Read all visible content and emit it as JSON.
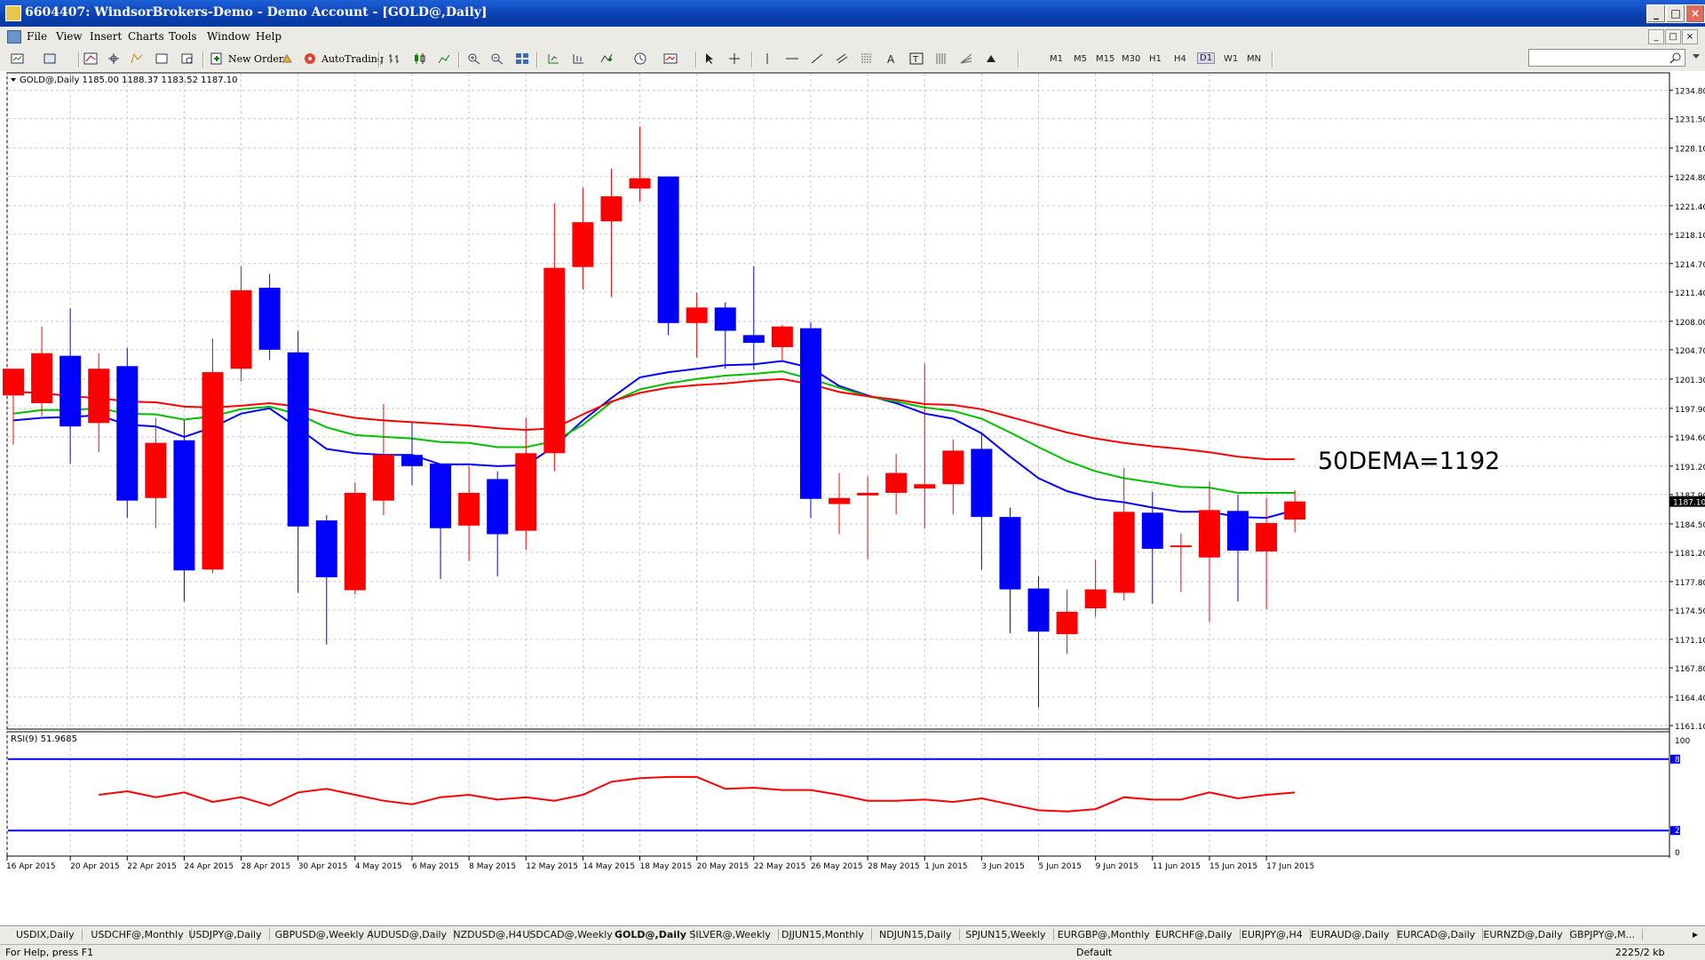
{
  "window": {
    "title": "6604407: WindsorBrokers-Demo - Demo Account - [GOLD@,Daily]",
    "minimize": "_",
    "maximize": "□",
    "close": "×"
  },
  "menu": {
    "items": [
      "File",
      "View",
      "Insert",
      "Charts",
      "Tools",
      "Window",
      "Help"
    ]
  },
  "toolbar": {
    "new_order": "New Order",
    "autotrading": "AutoTrading",
    "timeframes": [
      "M1",
      "M5",
      "M15",
      "M30",
      "H1",
      "H4",
      "D1",
      "W1",
      "MN"
    ],
    "active_timeframe": "D1"
  },
  "colors": {
    "bull": "#ff0000",
    "bear": "#0000ff",
    "ema_fast": "#0000ff",
    "ema_mid": "#00c000",
    "ema_slow": "#ff0000",
    "rsi_line": "#ff0000",
    "rsi_levels": "#0000ff",
    "grid": "#c8c8c8"
  },
  "chart_data": [
    {
      "type": "candlestick",
      "header": "GOLD@,Daily  1185.00 1188.37 1183.52 1187.10",
      "annotation": "50DEMA=1192",
      "current_price_label": "1187.10",
      "ylim": [
        1161.1,
        1235.8
      ],
      "grid": true,
      "y_ticks": [
        "1234.80",
        "1231.50",
        "1228.10",
        "1224.80",
        "1221.40",
        "1218.10",
        "1214.70",
        "1211.40",
        "1208.00",
        "1204.70",
        "1201.30",
        "1197.90",
        "1194.60",
        "1191.20",
        "1187.90",
        "1184.50",
        "1181.20",
        "1177.80",
        "1174.50",
        "1171.10",
        "1167.80",
        "1164.40",
        "1161.10"
      ],
      "x_ticks": [
        "16 Apr 2015",
        "20 Apr 2015",
        "22 Apr 2015",
        "24 Apr 2015",
        "28 Apr 2015",
        "30 Apr 2015",
        "4 May 2015",
        "6 May 2015",
        "8 May 2015",
        "12 May 2015",
        "14 May 2015",
        "18 May 2015",
        "20 May 2015",
        "22 May 2015",
        "26 May 2015",
        "28 May 2015",
        "1 Jun 2015",
        "3 Jun 2015",
        "5 Jun 2015",
        "9 Jun 2015",
        "11 Jun 2015",
        "15 Jun 2015",
        "17 Jun 2015"
      ],
      "candles": [
        {
          "o": 1199.4,
          "h": 1201.8,
          "l": 1193.7,
          "c": 1202.5
        },
        {
          "o": 1198.5,
          "h": 1207.4,
          "l": 1197.0,
          "c": 1204.3
        },
        {
          "o": 1204.0,
          "h": 1209.5,
          "l": 1191.5,
          "c": 1195.8
        },
        {
          "o": 1196.2,
          "h": 1204.3,
          "l": 1192.8,
          "c": 1202.5
        },
        {
          "o": 1202.8,
          "h": 1204.9,
          "l": 1185.2,
          "c": 1187.2
        },
        {
          "o": 1187.5,
          "h": 1196.8,
          "l": 1184.0,
          "c": 1193.9
        },
        {
          "o": 1194.2,
          "h": 1196.5,
          "l": 1175.5,
          "c": 1179.1
        },
        {
          "o": 1179.2,
          "h": 1206.0,
          "l": 1178.8,
          "c": 1202.1
        },
        {
          "o": 1202.5,
          "h": 1214.4,
          "l": 1201.0,
          "c": 1211.6
        },
        {
          "o": 1211.9,
          "h": 1213.5,
          "l": 1203.5,
          "c": 1204.7
        },
        {
          "o": 1204.4,
          "h": 1206.9,
          "l": 1176.5,
          "c": 1184.2
        },
        {
          "o": 1184.9,
          "h": 1185.5,
          "l": 1170.5,
          "c": 1178.3
        },
        {
          "o": 1176.8,
          "h": 1189.3,
          "l": 1176.3,
          "c": 1188.1
        },
        {
          "o": 1187.2,
          "h": 1198.4,
          "l": 1185.5,
          "c": 1192.5
        },
        {
          "o": 1192.5,
          "h": 1196.3,
          "l": 1189.0,
          "c": 1191.2
        },
        {
          "o": 1191.5,
          "h": 1191.5,
          "l": 1178.1,
          "c": 1184.0
        },
        {
          "o": 1184.3,
          "h": 1191.2,
          "l": 1180.2,
          "c": 1188.1
        },
        {
          "o": 1189.7,
          "h": 1190.6,
          "l": 1178.4,
          "c": 1183.3
        },
        {
          "o": 1183.7,
          "h": 1196.8,
          "l": 1181.5,
          "c": 1192.7
        },
        {
          "o": 1192.7,
          "h": 1221.7,
          "l": 1190.6,
          "c": 1214.2
        },
        {
          "o": 1214.3,
          "h": 1223.5,
          "l": 1211.7,
          "c": 1219.5
        },
        {
          "o": 1219.6,
          "h": 1225.7,
          "l": 1210.8,
          "c": 1222.5
        },
        {
          "o": 1223.4,
          "h": 1230.6,
          "l": 1221.9,
          "c": 1224.6
        },
        {
          "o": 1224.8,
          "h": 1224.8,
          "l": 1206.4,
          "c": 1207.8
        },
        {
          "o": 1207.8,
          "h": 1211.3,
          "l": 1203.8,
          "c": 1209.6
        },
        {
          "o": 1209.6,
          "h": 1210.2,
          "l": 1202.5,
          "c": 1206.9
        },
        {
          "o": 1206.4,
          "h": 1214.4,
          "l": 1202.4,
          "c": 1205.5
        },
        {
          "o": 1205.0,
          "h": 1207.6,
          "l": 1203.4,
          "c": 1207.4
        },
        {
          "o": 1207.2,
          "h": 1207.9,
          "l": 1185.2,
          "c": 1187.4
        },
        {
          "o": 1186.8,
          "h": 1190.4,
          "l": 1183.3,
          "c": 1187.5
        },
        {
          "o": 1187.8,
          "h": 1190.0,
          "l": 1180.4,
          "c": 1188.1
        },
        {
          "o": 1188.1,
          "h": 1192.6,
          "l": 1185.6,
          "c": 1190.4
        },
        {
          "o": 1188.6,
          "h": 1203.1,
          "l": 1184.0,
          "c": 1189.1
        },
        {
          "o": 1189.1,
          "h": 1194.3,
          "l": 1185.6,
          "c": 1193.0
        },
        {
          "o": 1193.2,
          "h": 1195.1,
          "l": 1179.2,
          "c": 1185.3
        },
        {
          "o": 1185.3,
          "h": 1186.4,
          "l": 1171.8,
          "c": 1176.9
        },
        {
          "o": 1177.0,
          "h": 1178.4,
          "l": 1163.2,
          "c": 1172.0
        },
        {
          "o": 1171.7,
          "h": 1176.9,
          "l": 1169.4,
          "c": 1174.3
        },
        {
          "o": 1174.7,
          "h": 1180.3,
          "l": 1173.7,
          "c": 1176.9
        },
        {
          "o": 1176.5,
          "h": 1191.0,
          "l": 1175.6,
          "c": 1185.9
        },
        {
          "o": 1185.8,
          "h": 1188.2,
          "l": 1175.2,
          "c": 1181.6
        },
        {
          "o": 1182.0,
          "h": 1183.4,
          "l": 1176.6,
          "c": 1182.0
        },
        {
          "o": 1180.6,
          "h": 1189.4,
          "l": 1173.1,
          "c": 1186.1
        },
        {
          "o": 1186.0,
          "h": 1187.9,
          "l": 1175.5,
          "c": 1181.4
        },
        {
          "o": 1181.3,
          "h": 1187.5,
          "l": 1174.6,
          "c": 1184.6
        },
        {
          "o": 1185.0,
          "h": 1188.4,
          "l": 1183.5,
          "c": 1187.1
        }
      ],
      "ema_series": [
        {
          "values": [
            1196.5,
            1196.8,
            1196.9,
            1197.1,
            1196.0,
            1195.8,
            1194.6,
            1195.7,
            1197.3,
            1197.9,
            1195.6,
            1193.2,
            1192.7,
            1192.5,
            1192.5,
            1191.4,
            1191.4,
            1191.2,
            1191.3,
            1193.5,
            1196.5,
            1199.1,
            1201.5,
            1202.1,
            1202.5,
            1202.9,
            1203.0,
            1203.4,
            1202.6,
            1200.5,
            1199.4,
            1198.5,
            1197.3,
            1196.7,
            1195.0,
            1192.3,
            1189.8,
            1188.3,
            1187.4,
            1187.0,
            1186.4,
            1185.9,
            1185.9,
            1185.3,
            1185.2,
            1186.1
          ]
        },
        {
          "values": [
            1197.3,
            1197.7,
            1197.7,
            1197.9,
            1197.3,
            1197.2,
            1196.6,
            1197.0,
            1197.8,
            1198.1,
            1197.2,
            1195.7,
            1194.8,
            1194.6,
            1194.4,
            1194.0,
            1193.9,
            1193.4,
            1193.4,
            1194.1,
            1196.0,
            1198.6,
            1200.1,
            1200.8,
            1201.3,
            1201.7,
            1201.9,
            1202.2,
            1201.3,
            1200.3,
            1199.3,
            1198.7,
            1198.0,
            1197.6,
            1196.7,
            1195.1,
            1193.4,
            1191.8,
            1190.6,
            1189.8,
            1189.3,
            1188.8,
            1188.7,
            1188.1,
            1188.1,
            1188.1
          ]
        },
        {
          "values": [
            1199.8,
            1199.7,
            1199.3,
            1199.1,
            1198.7,
            1198.6,
            1198.1,
            1198.0,
            1198.2,
            1198.5,
            1198.1,
            1197.4,
            1196.8,
            1196.5,
            1196.3,
            1196.1,
            1195.9,
            1195.6,
            1195.4,
            1195.6,
            1197.2,
            1198.7,
            1199.7,
            1200.3,
            1200.6,
            1200.8,
            1201.1,
            1201.3,
            1200.7,
            1199.8,
            1199.3,
            1198.9,
            1198.4,
            1198.3,
            1197.8,
            1196.9,
            1196.0,
            1195.1,
            1194.4,
            1193.9,
            1193.5,
            1193.2,
            1192.8,
            1192.3,
            1192.0,
            1192.0
          ]
        }
      ]
    },
    {
      "type": "line",
      "header": "RSI(9) 51.9685",
      "ylim": [
        0,
        100
      ],
      "y_ticks": [
        "100",
        "80",
        "20",
        "0"
      ],
      "levels": [
        80,
        20
      ],
      "series": [
        {
          "values": [
            50,
            53,
            48,
            52,
            44,
            48,
            41,
            52,
            55,
            50,
            45,
            42,
            48,
            50,
            46,
            48,
            45,
            50,
            61,
            64,
            65,
            65,
            55,
            56,
            54,
            54,
            50,
            45,
            45,
            46,
            44,
            47,
            42,
            37,
            36,
            38,
            48,
            46,
            46,
            52,
            47,
            50,
            51.97
          ]
        }
      ]
    }
  ],
  "symbol_tabs": [
    "USDIX,Daily",
    "USDCHF@,Monthly",
    "USDJPY@,Daily",
    "GBPUSD@,Weekly",
    "AUDUSD@,Daily",
    "NZDUSD@,H4",
    "USDCAD@,Weekly",
    "GOLD@,Daily",
    "SILVER@,Weekly",
    "DJJUN15,Monthly",
    "NDJUN15,Daily",
    "SPJUN15,Weekly",
    "EURGBP@,Monthly",
    "EURCHF@,Daily",
    "EURJPY@,H4",
    "EURAUD@,Daily",
    "EURCAD@,Daily",
    "EURNZD@,Daily",
    "GBPJPY@,M..."
  ],
  "status": {
    "help": "For Help, press F1",
    "profile": "Default",
    "traffic": "2225/2 kb"
  }
}
